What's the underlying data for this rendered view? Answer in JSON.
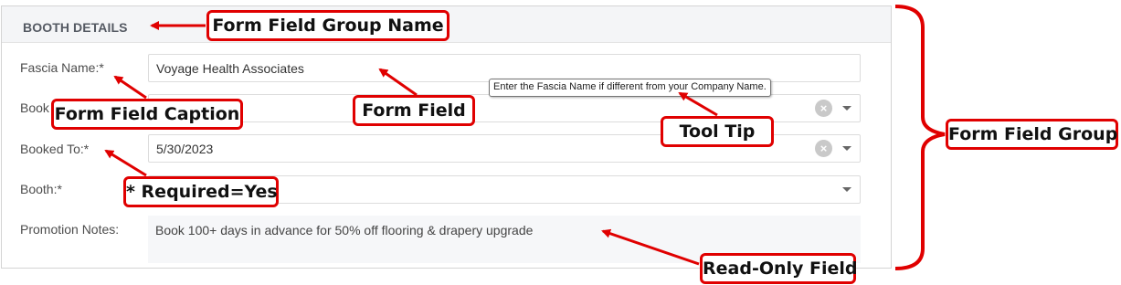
{
  "group": {
    "title": "BOOTH DETAILS"
  },
  "fields": [
    {
      "caption": "Fascia Name:*",
      "value": "Voyage Health Associates"
    },
    {
      "caption": "Book",
      "value": ""
    },
    {
      "caption": "Booked To:*",
      "value": "5/30/2023"
    },
    {
      "caption": "Booth:*",
      "value": ""
    },
    {
      "caption": "Promotion Notes:",
      "value": "Book 100+ days in advance for 50% off flooring & drapery upgrade"
    }
  ],
  "tooltip": "Enter the Fascia Name if different from your Company Name.",
  "callouts": {
    "group_name": "Form Field Group Name",
    "field_caption": "Form Field Caption",
    "form_field": "Form Field",
    "tool_tip": "Tool Tip",
    "form_field_group": "Form Field Group",
    "required": "* Required=Yes",
    "read_only": "Read-Only Field"
  },
  "colors": {
    "annotation": "#e00000",
    "panel_border": "#d4d4d4",
    "header_bg": "#f4f5f7"
  },
  "icons": {
    "clear": "clear-circle-icon",
    "dropdown": "caret-down-icon"
  }
}
